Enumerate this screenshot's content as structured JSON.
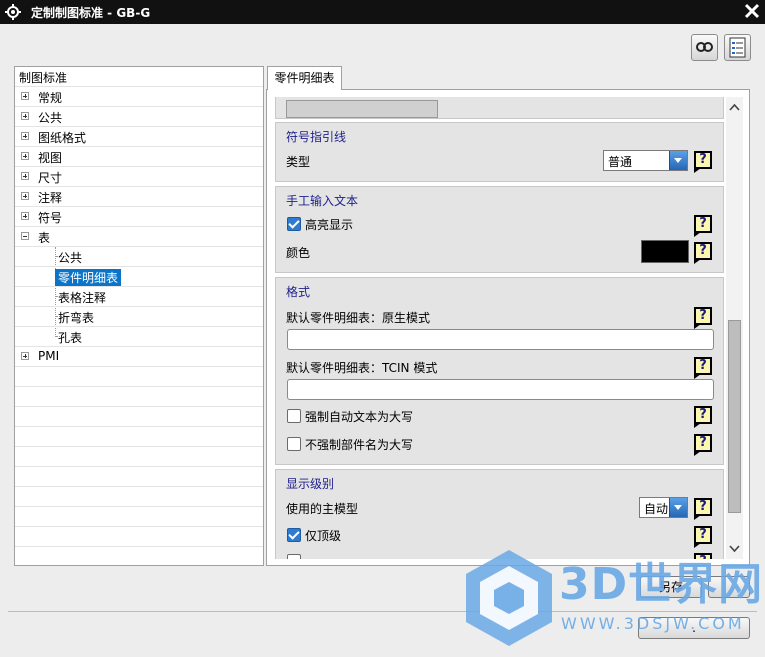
{
  "window": {
    "title": "定制制图标准 - GB-G"
  },
  "tree": {
    "root_label": "制图标准",
    "items": [
      {
        "label": "常规",
        "level": 0,
        "expander": "plus"
      },
      {
        "label": "公共",
        "level": 0,
        "expander": "plus"
      },
      {
        "label": "图纸格式",
        "level": 0,
        "expander": "plus"
      },
      {
        "label": "视图",
        "level": 0,
        "expander": "plus"
      },
      {
        "label": "尺寸",
        "level": 0,
        "expander": "plus"
      },
      {
        "label": "注释",
        "level": 0,
        "expander": "plus"
      },
      {
        "label": "符号",
        "level": 0,
        "expander": "plus"
      },
      {
        "label": "表",
        "level": 0,
        "expander": "minus"
      },
      {
        "label": "公共",
        "level": 1
      },
      {
        "label": "零件明细表",
        "level": 1,
        "selected": true
      },
      {
        "label": "表格注释",
        "level": 1
      },
      {
        "label": "折弯表",
        "level": 1
      },
      {
        "label": "孔表",
        "level": 1
      },
      {
        "label": "PMI",
        "level": 0,
        "expander": "plus"
      }
    ]
  },
  "tab": {
    "label": "零件明细表"
  },
  "sections": {
    "leader": {
      "header": "符号指引线",
      "type_label": "类型",
      "type_value": "普通"
    },
    "manual_text": {
      "header": "手工输入文本",
      "highlight_label": "高亮显示",
      "highlight_checked": true,
      "color_label": "颜色",
      "color_value": "#000000"
    },
    "format": {
      "header": "格式",
      "native_label": "默认零件明细表：原生模式",
      "native_value": "",
      "tcin_label": "默认零件明细表：TCIN 模式",
      "tcin_value": "",
      "force_upper_label": "强制自动文本为大写",
      "force_upper_checked": false,
      "no_force_part_label": "不强制部件名为大写",
      "no_force_part_checked": false
    },
    "display_level": {
      "header": "显示级别",
      "master_model_label": "使用的主模型",
      "master_model_value": "自动",
      "top_level_label": "仅顶级",
      "top_level_checked": true
    }
  },
  "help": {
    "icon_text": "?"
  },
  "buttons": {
    "ok_partial": "另存",
    "cancel_partial": "."
  },
  "watermark": {
    "brand": "3D世界网",
    "url": "WWW.3DSJW.COM"
  },
  "colors": {
    "selection": "#0b74c8",
    "titlebar": "#111111",
    "group_header": "#1e1e8c"
  }
}
